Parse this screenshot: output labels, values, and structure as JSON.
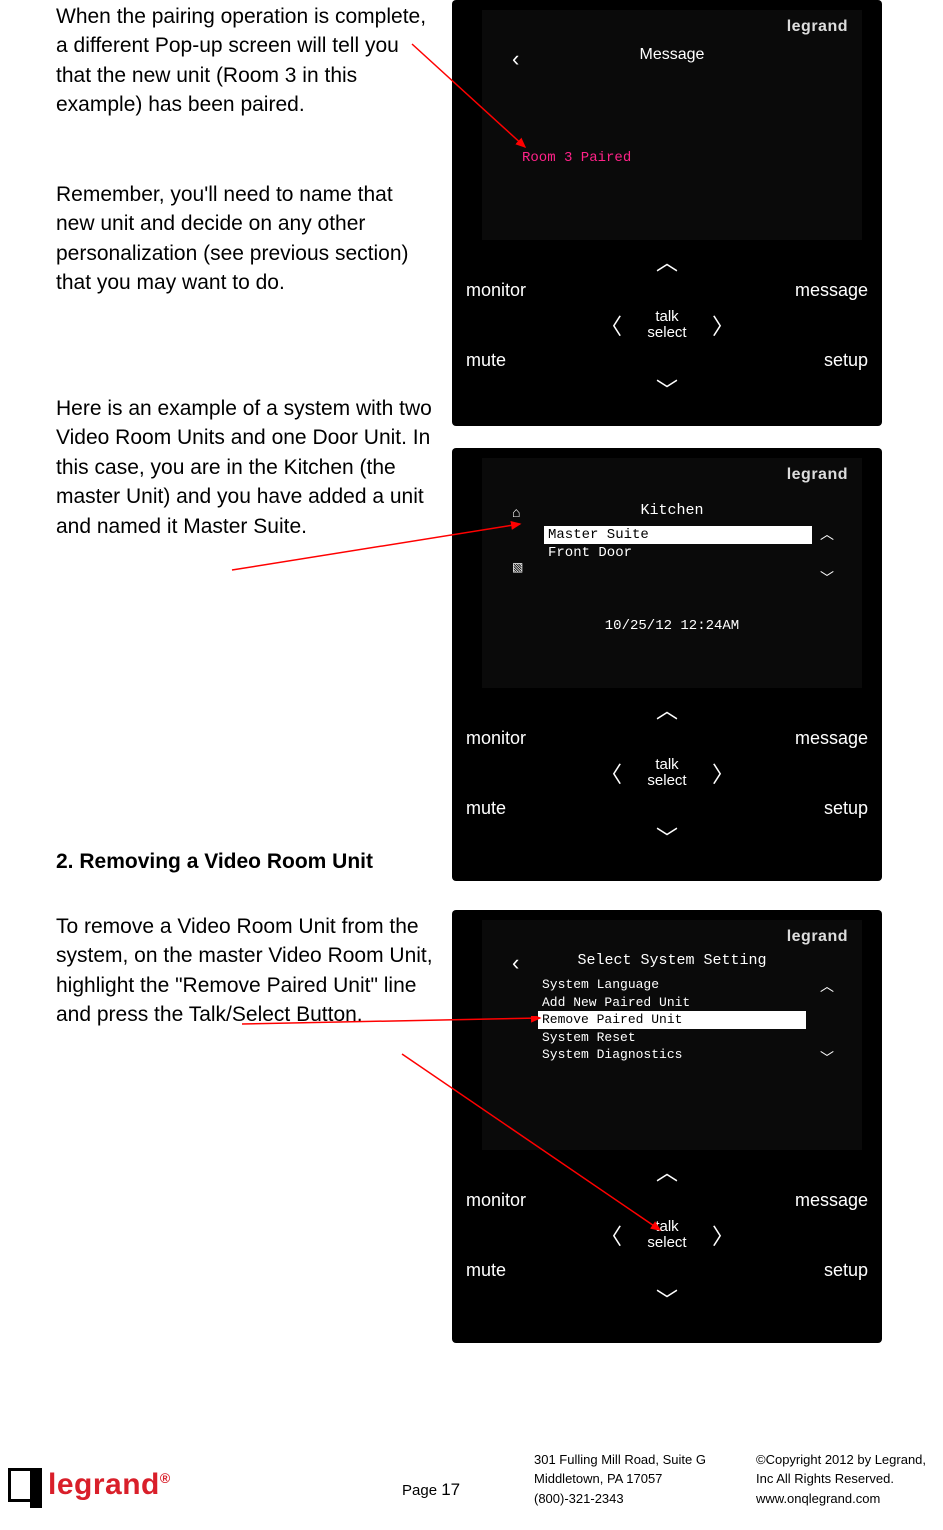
{
  "text": {
    "p1": "When the pairing operation is complete, a different Pop-up screen will tell you that the new unit (Room 3 in this example) has been paired.",
    "p2": "Remember, you'll need to name that new unit and decide on any other personalization (see previous section) that you may want to do.",
    "p3": "Here is an example of a system with two Video Room Units and one Door Unit. In this case, you are in the Kitchen (the master Unit) and you have added a unit and named it Master Suite.",
    "h1": "2. Removing a Video Room Unit",
    "p4a": "To remove a Video Room Unit from the system, on the master Video Room Unit, highlight the \"Remove Paired Unit\" line",
    "p4b": "and press the Talk/Select Button."
  },
  "device": {
    "brand": "legrand",
    "controls": {
      "monitor": "monitor",
      "mute": "mute",
      "message": "message",
      "setup": "setup",
      "talk": "talk",
      "select": "select"
    }
  },
  "screen1": {
    "title": "Message",
    "popup": "Room 3 Paired"
  },
  "screen2": {
    "title": "Kitchen",
    "items": [
      "Master Suite",
      "Front Door"
    ],
    "selected_index": 0,
    "datetime": "10/25/12 12:24AM"
  },
  "screen3": {
    "title": "Select System Setting",
    "items": [
      "System Language",
      "Add New Paired Unit",
      "Remove Paired Unit",
      "System Reset",
      "System Diagnostics"
    ],
    "selected_index": 2
  },
  "footer": {
    "logo_text": "legrand",
    "page_label": "Page",
    "page_num": "17",
    "addr1": "301 Fulling Mill Road, Suite G",
    "addr2": "Middletown, PA   17057",
    "addr3": "(800)-321-2343",
    "copy1": "©Copyright 2012 by Legrand,",
    "copy2": "Inc All Rights Reserved.",
    "copy3": "www.onqlegrand.com"
  }
}
